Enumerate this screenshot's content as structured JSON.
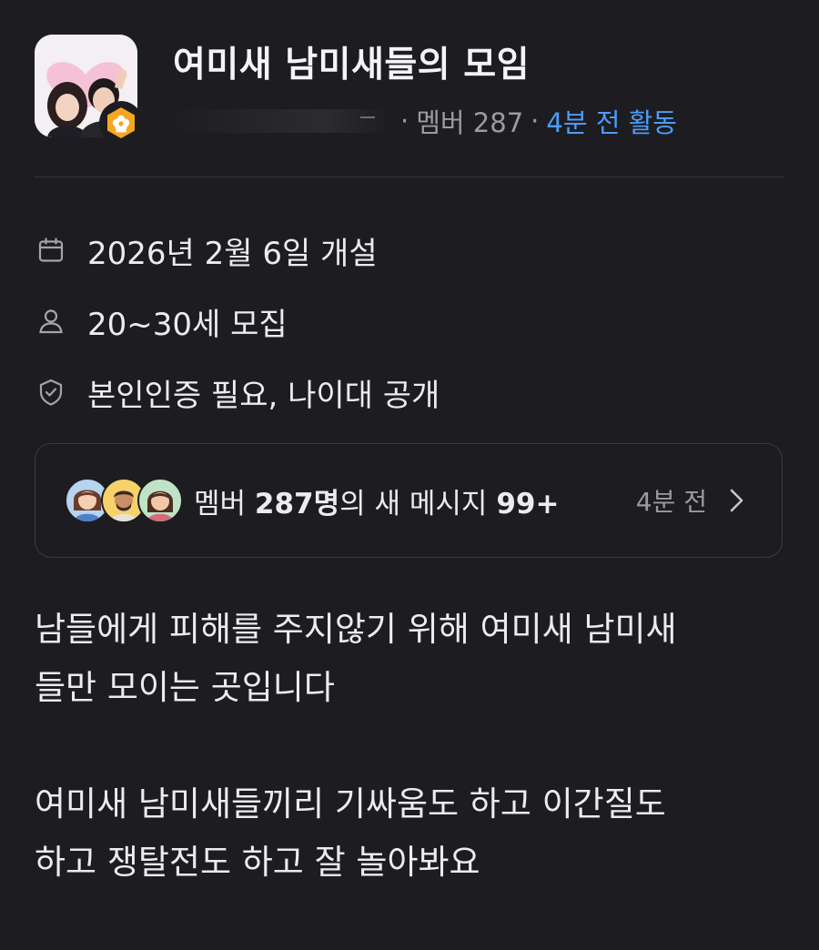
{
  "group": {
    "title": "여미새 남미새들의 모임",
    "member_count": "멤버 287",
    "separator": "·",
    "last_activity": "4분 전 활동"
  },
  "info": [
    {
      "icon": "calendar-icon",
      "text": "2026년 2월 6일 개설"
    },
    {
      "icon": "person-icon",
      "text": "20~30세 모집"
    },
    {
      "icon": "shield-check-icon",
      "text": "본인인증 필요, 나이대 공개"
    }
  ],
  "member_card": {
    "prefix": "멤버 ",
    "count": "287명",
    "middle": "의 새 메시지 ",
    "new_messages": "99+",
    "time": "4분 전",
    "chevron": "chevron-right-icon"
  },
  "description": {
    "paragraph_1": "남들에게 피해를 주지않기 위해 여미새 남미새\n들만 모이는 곳입니다",
    "paragraph_2": "여미새 남미새들끼리 기싸움도 하고 이간질도\n하고 쟁탈전도 하고 잘 놀아봐요"
  },
  "colors": {
    "background": "#1d1d21",
    "text": "#ececee",
    "muted": "#9a9aa0",
    "accent_blue": "#4e9cf7",
    "badge_orange": "#f5a623",
    "card_border": "#3a3a40"
  }
}
